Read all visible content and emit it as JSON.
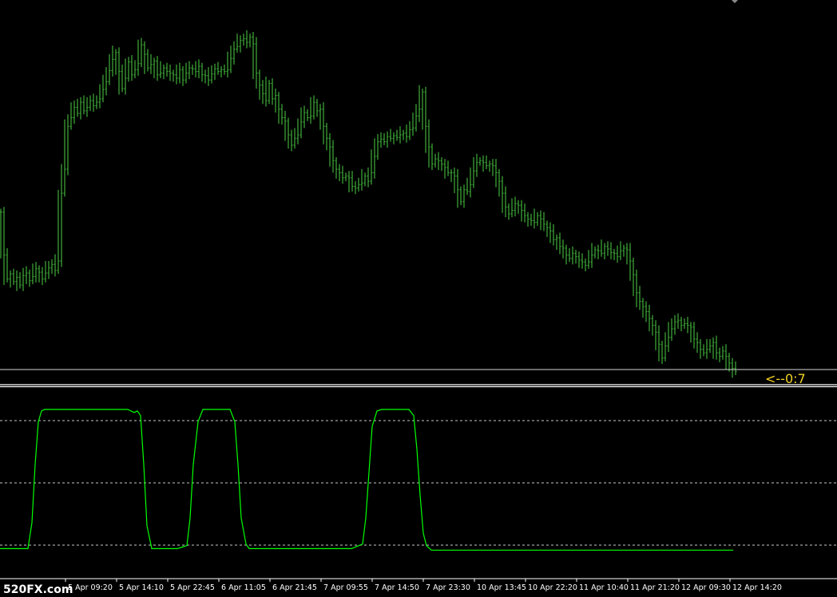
{
  "chart_data": [
    {
      "type": "bar",
      "style": "ohlc",
      "panel": "price",
      "color": "#3fae3a",
      "y_axis_labels_visible": false,
      "grid": false,
      "series_points": [
        [
          0,
          190
        ],
        [
          4,
          140
        ],
        [
          8,
          112
        ],
        [
          12,
          118
        ],
        [
          16,
          109
        ],
        [
          20,
          114
        ],
        [
          24,
          105
        ],
        [
          28,
          116
        ],
        [
          32,
          119
        ],
        [
          36,
          110
        ],
        [
          40,
          115
        ],
        [
          44,
          124
        ],
        [
          48,
          120
        ],
        [
          52,
          112
        ],
        [
          56,
          119
        ],
        [
          60,
          125
        ],
        [
          64,
          129
        ],
        [
          68,
          122
        ],
        [
          72,
          133
        ],
        [
          76,
          212
        ],
        [
          80,
          240
        ],
        [
          84,
          290
        ],
        [
          88,
          300
        ],
        [
          92,
          312
        ],
        [
          96,
          305
        ],
        [
          100,
          318
        ],
        [
          104,
          308
        ],
        [
          108,
          312
        ],
        [
          112,
          320
        ],
        [
          116,
          314
        ],
        [
          120,
          318
        ],
        [
          124,
          322
        ],
        [
          128,
          333
        ],
        [
          132,
          342
        ],
        [
          136,
          355
        ],
        [
          140,
          368
        ],
        [
          144,
          376
        ],
        [
          148,
          354
        ],
        [
          152,
          334
        ],
        [
          156,
          346
        ],
        [
          160,
          365
        ],
        [
          164,
          350
        ],
        [
          168,
          356
        ],
        [
          172,
          363
        ],
        [
          176,
          385
        ],
        [
          180,
          374
        ],
        [
          184,
          358
        ],
        [
          188,
          362
        ],
        [
          192,
          366
        ],
        [
          196,
          350
        ],
        [
          200,
          352
        ],
        [
          204,
          358
        ],
        [
          208,
          354
        ],
        [
          212,
          352
        ],
        [
          216,
          350
        ],
        [
          220,
          346
        ],
        [
          224,
          356
        ],
        [
          228,
          344
        ],
        [
          232,
          352
        ],
        [
          236,
          358
        ],
        [
          240,
          357
        ],
        [
          244,
          354
        ],
        [
          248,
          360
        ],
        [
          252,
          350
        ],
        [
          256,
          349
        ],
        [
          260,
          344
        ],
        [
          264,
          351
        ],
        [
          268,
          357
        ],
        [
          272,
          354
        ],
        [
          276,
          356
        ],
        [
          280,
          354
        ],
        [
          284,
          356
        ],
        [
          288,
          369
        ],
        [
          292,
          380
        ],
        [
          296,
          383
        ],
        [
          300,
          390
        ],
        [
          304,
          392
        ],
        [
          308,
          388
        ],
        [
          312,
          394
        ],
        [
          316,
          386
        ],
        [
          320,
          352
        ],
        [
          324,
          338
        ],
        [
          328,
          328
        ],
        [
          332,
          320
        ],
        [
          336,
          340
        ],
        [
          340,
          322
        ],
        [
          344,
          326
        ],
        [
          348,
          310
        ],
        [
          352,
          300
        ],
        [
          356,
          296
        ],
        [
          360,
          280
        ],
        [
          364,
          268
        ],
        [
          368,
          276
        ],
        [
          372,
          280
        ],
        [
          376,
          295
        ],
        [
          380,
          306
        ],
        [
          384,
          300
        ],
        [
          388,
          302
        ],
        [
          392,
          318
        ],
        [
          396,
          308
        ],
        [
          400,
          310
        ],
        [
          404,
          290
        ],
        [
          408,
          276
        ],
        [
          412,
          266
        ],
        [
          416,
          250
        ],
        [
          420,
          240
        ],
        [
          424,
          236
        ],
        [
          428,
          230
        ],
        [
          432,
          232
        ],
        [
          436,
          230
        ],
        [
          440,
          220
        ],
        [
          444,
          218
        ],
        [
          448,
          222
        ],
        [
          452,
          224
        ],
        [
          456,
          232
        ],
        [
          460,
          226
        ],
        [
          464,
          236
        ],
        [
          468,
          255
        ],
        [
          472,
          272
        ],
        [
          476,
          275
        ],
        [
          480,
          272
        ],
        [
          484,
          278
        ],
        [
          488,
          276
        ],
        [
          492,
          279
        ],
        [
          496,
          277
        ],
        [
          500,
          280
        ],
        [
          504,
          282
        ],
        [
          508,
          278
        ],
        [
          512,
          286
        ],
        [
          516,
          288
        ],
        [
          520,
          302
        ],
        [
          524,
          310
        ],
        [
          528,
          330
        ],
        [
          532,
          290
        ],
        [
          536,
          266
        ],
        [
          540,
          246
        ],
        [
          544,
          252
        ],
        [
          548,
          250
        ],
        [
          552,
          246
        ],
        [
          556,
          242
        ],
        [
          560,
          236
        ],
        [
          564,
          236
        ],
        [
          568,
          232
        ],
        [
          572,
          216
        ],
        [
          576,
          202
        ],
        [
          580,
          216
        ],
        [
          584,
          214
        ],
        [
          588,
          222
        ],
        [
          592,
          238
        ],
        [
          596,
          248
        ],
        [
          600,
          250
        ],
        [
          604,
          248
        ],
        [
          608,
          244
        ],
        [
          612,
          246
        ],
        [
          616,
          244
        ],
        [
          620,
          236
        ],
        [
          624,
          226
        ],
        [
          628,
          212
        ],
        [
          632,
          196
        ],
        [
          636,
          188
        ],
        [
          640,
          192
        ],
        [
          644,
          200
        ],
        [
          648,
          198
        ],
        [
          652,
          192
        ],
        [
          656,
          186
        ],
        [
          660,
          182
        ],
        [
          664,
          180
        ],
        [
          668,
          178
        ],
        [
          672,
          186
        ],
        [
          676,
          182
        ],
        [
          680,
          176
        ],
        [
          684,
          172
        ],
        [
          688,
          168
        ],
        [
          692,
          158
        ],
        [
          696,
          160
        ],
        [
          700,
          150
        ],
        [
          704,
          148
        ],
        [
          708,
          140
        ],
        [
          712,
          136
        ],
        [
          716,
          142
        ],
        [
          720,
          138
        ],
        [
          724,
          134
        ],
        [
          728,
          132
        ],
        [
          732,
          128
        ],
        [
          736,
          132
        ],
        [
          740,
          140
        ],
        [
          744,
          146
        ],
        [
          748,
          145
        ],
        [
          752,
          142
        ],
        [
          756,
          150
        ],
        [
          760,
          147
        ],
        [
          764,
          143
        ],
        [
          768,
          142
        ],
        [
          772,
          138
        ],
        [
          776,
          145
        ],
        [
          780,
          148
        ],
        [
          784,
          146
        ],
        [
          788,
          133
        ],
        [
          792,
          117
        ],
        [
          796,
          96
        ],
        [
          800,
          86
        ],
        [
          804,
          80
        ],
        [
          808,
          74
        ],
        [
          812,
          66
        ],
        [
          816,
          58
        ],
        [
          820,
          50
        ],
        [
          824,
          36
        ],
        [
          828,
          20
        ],
        [
          832,
          34
        ],
        [
          836,
          44
        ],
        [
          840,
          54
        ],
        [
          844,
          62
        ],
        [
          848,
          64
        ],
        [
          852,
          58
        ],
        [
          856,
          60
        ],
        [
          860,
          58
        ],
        [
          864,
          56
        ],
        [
          868,
          42
        ],
        [
          872,
          38
        ],
        [
          876,
          30
        ],
        [
          880,
          26
        ],
        [
          884,
          30
        ],
        [
          888,
          34
        ],
        [
          892,
          38
        ],
        [
          896,
          26
        ],
        [
          900,
          22
        ],
        [
          904,
          28
        ],
        [
          908,
          22
        ],
        [
          912,
          14
        ],
        [
          916,
          8
        ],
        [
          920,
          4
        ]
      ]
    },
    {
      "type": "line",
      "panel": "indicator",
      "color": "#00ff00",
      "ylim": [
        0,
        100
      ],
      "levels": [
        80,
        50,
        20
      ],
      "grid": false,
      "values": [
        [
          0,
          5
        ],
        [
          35,
          5
        ],
        [
          40,
          22
        ],
        [
          44,
          60
        ],
        [
          48,
          88
        ],
        [
          52,
          95
        ],
        [
          56,
          96
        ],
        [
          100,
          96
        ],
        [
          140,
          96
        ],
        [
          160,
          96
        ],
        [
          168,
          94
        ],
        [
          172,
          95
        ],
        [
          176,
          92
        ],
        [
          180,
          60
        ],
        [
          184,
          20
        ],
        [
          190,
          5
        ],
        [
          222,
          5
        ],
        [
          228,
          6
        ],
        [
          234,
          7
        ],
        [
          238,
          25
        ],
        [
          242,
          60
        ],
        [
          248,
          88
        ],
        [
          254,
          96
        ],
        [
          288,
          96
        ],
        [
          294,
          88
        ],
        [
          298,
          60
        ],
        [
          302,
          25
        ],
        [
          308,
          8
        ],
        [
          312,
          5
        ],
        [
          440,
          5
        ],
        [
          454,
          8
        ],
        [
          458,
          25
        ],
        [
          462,
          55
        ],
        [
          466,
          85
        ],
        [
          472,
          95
        ],
        [
          478,
          96
        ],
        [
          512,
          96
        ],
        [
          518,
          92
        ],
        [
          522,
          70
        ],
        [
          526,
          40
        ],
        [
          530,
          15
        ],
        [
          534,
          7
        ],
        [
          540,
          4
        ],
        [
          560,
          4
        ],
        [
          918,
          4
        ]
      ]
    }
  ],
  "x_tick_labels": [
    "5 Apr 09:20",
    "5 Apr 14:10",
    "5 Apr 22:45",
    "6 Apr 11:05",
    "6 Apr 21:45",
    "7 Apr 09:55",
    "7 Apr 14:50",
    "7 Apr 23:30",
    "10 Apr 13:45",
    "10 Apr 22:20",
    "11 Apr 10:40",
    "11 Apr 21:20",
    "12 Apr 09:30",
    "12 Apr 14:20"
  ],
  "countdown_label": "<--0:7",
  "watermark": "520FX.com",
  "colors": {
    "background": "#000000",
    "price_bars": "#3fae3a",
    "indicator_line": "#00ff00",
    "level_lines": "#c8c8c8",
    "countdown": "#f2d227",
    "axis_text": "#ffffff"
  }
}
